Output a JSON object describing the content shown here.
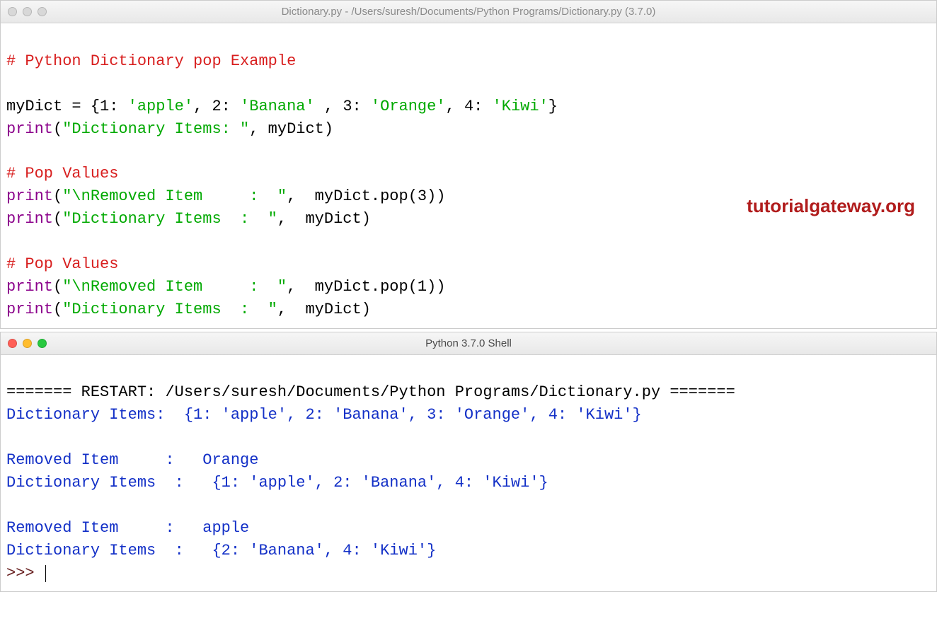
{
  "editor": {
    "title": "Dictionary.py - /Users/suresh/Documents/Python Programs/Dictionary.py (3.7.0)",
    "c1": "# Python Dictionary pop Example",
    "assign_left": "myDict = {",
    "k1": "1",
    "v1": "'apple'",
    "k2": "2",
    "v2": "'Banana'",
    "k3": "3",
    "v3": "'Orange'",
    "k4": "4",
    "v4": "'Kiwi'",
    "assign_right": "}",
    "print": "print",
    "s_dict_items": "\"Dictionary Items: \"",
    "comma_mydict": ", myDict)",
    "c2": "# Pop Values",
    "s_removed": "\"\\nRemoved Item     :  \"",
    "tail_pop3": ",  myDict.pop(",
    "pop3_arg": "3",
    "tail_close": "))",
    "s_dict_items2": "\"Dictionary Items  :  \"",
    "tail_mydict": ",  myDict)",
    "c3": "# Pop Values",
    "tail_pop1": ",  myDict.pop(",
    "pop1_arg": "1",
    "open_paren": "("
  },
  "watermark": "tutorialgateway.org",
  "shell": {
    "title": "Python 3.7.0 Shell",
    "restart_left": "=======",
    "restart_mid": " RESTART: /Users/suresh/Documents/Python Programs/Dictionary.py ",
    "restart_right": "=======",
    "o1": "Dictionary Items:  {1: 'apple', 2: 'Banana', 3: 'Orange', 4: 'Kiwi'}",
    "o2": "Removed Item     :   Orange",
    "o3": "Dictionary Items  :   {1: 'apple', 2: 'Banana', 4: 'Kiwi'}",
    "o4": "Removed Item     :   apple",
    "o5": "Dictionary Items  :   {2: 'Banana', 4: 'Kiwi'}",
    "prompt": ">>> "
  }
}
